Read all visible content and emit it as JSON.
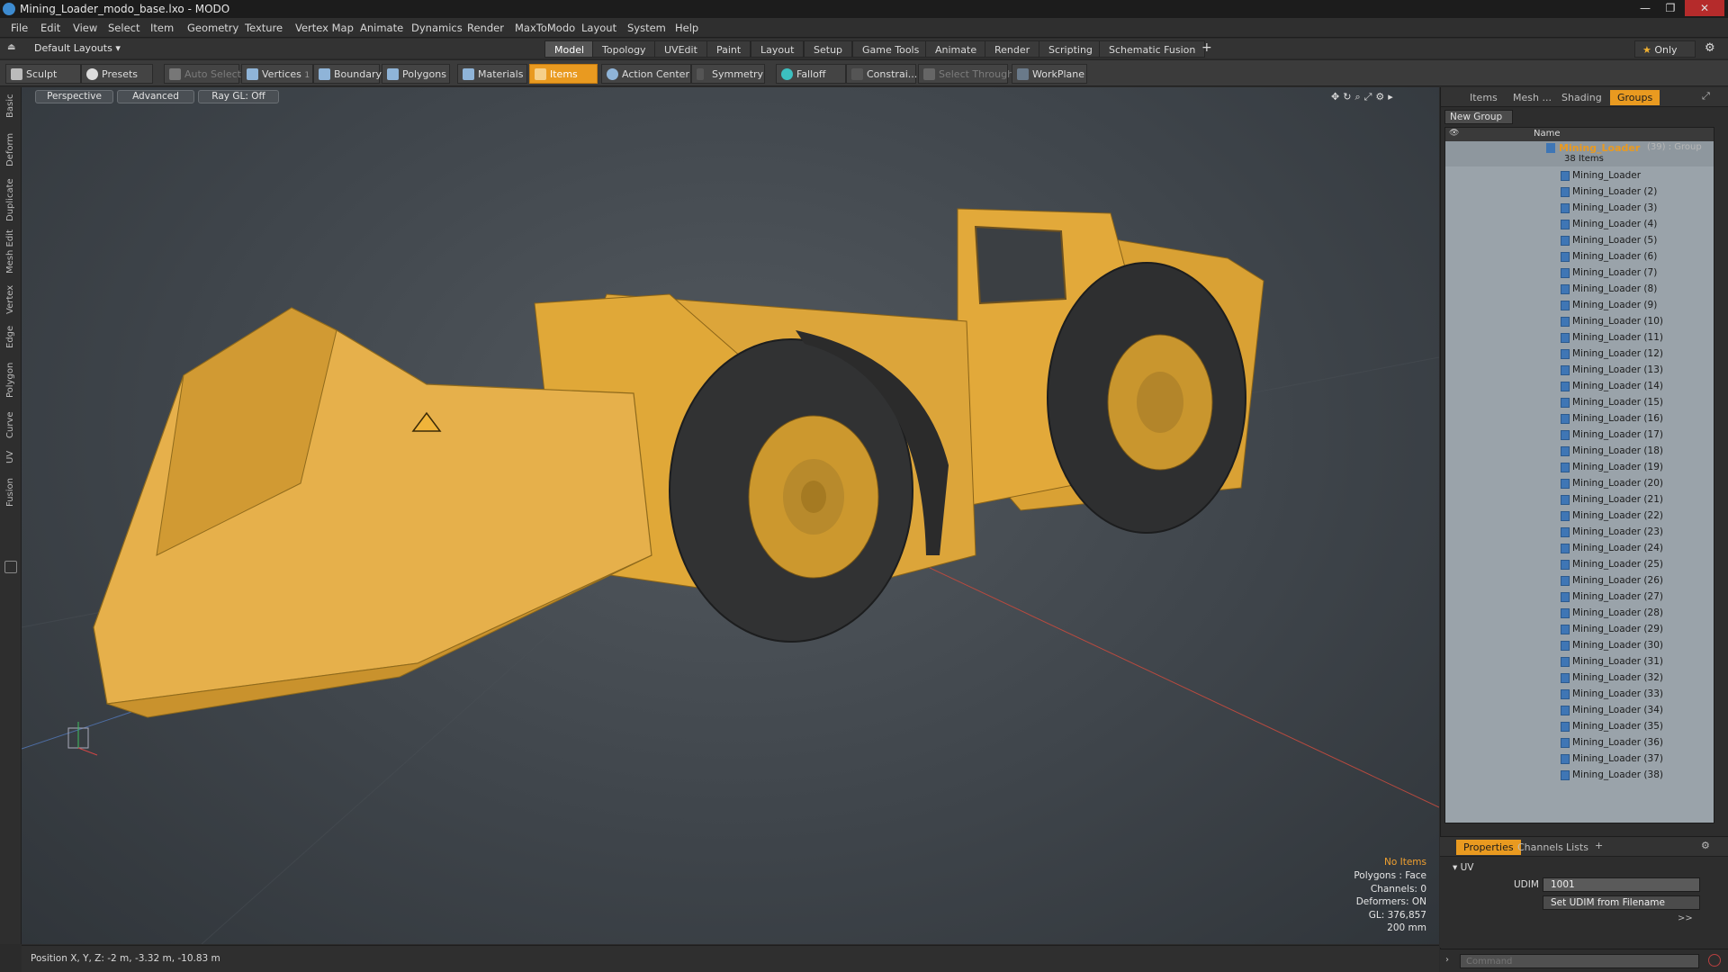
{
  "window": {
    "title": "Mining_Loader_modo_base.lxo - MODO"
  },
  "menu": [
    "File",
    "Edit",
    "View",
    "Select",
    "Item",
    "Geometry",
    "Texture",
    "Vertex Map",
    "Animate",
    "Dynamics",
    "Render",
    "MaxToModo",
    "Layout",
    "System",
    "Help"
  ],
  "layout_bar": {
    "layout_selector": "Default Layouts",
    "tabs": [
      "Model",
      "Topology",
      "UVEdit",
      "Paint",
      "Layout",
      "Setup",
      "Game Tools",
      "Animate",
      "Render",
      "Scripting",
      "Schematic Fusion"
    ],
    "active_tab": "Model",
    "plus": "+",
    "only_label": "Only"
  },
  "toolbar": {
    "sculpt": "Sculpt",
    "presets": "Presets",
    "auto_select": "Auto Select",
    "vertices": "Vertices",
    "vertices_count": "1",
    "boundary": "Boundary",
    "polygons": "Polygons",
    "materials": "Materials",
    "items": "Items",
    "action_center": "Action Center",
    "symmetry": "Symmetry",
    "falloff": "Falloff",
    "constrain": "Constrai...",
    "select_through": "Select Through",
    "workplane": "WorkPlane"
  },
  "left_tabs": [
    "Basic",
    "Deform",
    "Duplicate",
    "Mesh Edit",
    "Vertex",
    "Edge",
    "Polygon",
    "Curve",
    "UV",
    "Fusion"
  ],
  "viewport": {
    "view_mode": "Perspective",
    "shading": "Advanced",
    "raygl": "Ray GL: Off",
    "info": {
      "selection": "No Items",
      "polygons": "Polygons : Face",
      "channels": "Channels: 0",
      "deformers": "Deformers: ON",
      "gl": "GL: 376,857",
      "scale": "200 mm"
    },
    "position": "Position X, Y, Z:  -2 m, -3.32 m, -10.83 m"
  },
  "right_panel": {
    "tabs": [
      "Items",
      "Mesh ...",
      "Shading",
      "Groups"
    ],
    "active_tab": "Groups",
    "new_group": "New Group",
    "column_name": "Name",
    "group": {
      "name": "Mining_Loader",
      "count_suffix": "(39) : Group",
      "items_label": "38 Items"
    },
    "items": [
      "Mining_Loader",
      "Mining_Loader (2)",
      "Mining_Loader (3)",
      "Mining_Loader (4)",
      "Mining_Loader (5)",
      "Mining_Loader (6)",
      "Mining_Loader (7)",
      "Mining_Loader (8)",
      "Mining_Loader (9)",
      "Mining_Loader (10)",
      "Mining_Loader (11)",
      "Mining_Loader (12)",
      "Mining_Loader (13)",
      "Mining_Loader (14)",
      "Mining_Loader (15)",
      "Mining_Loader (16)",
      "Mining_Loader (17)",
      "Mining_Loader (18)",
      "Mining_Loader (19)",
      "Mining_Loader (20)",
      "Mining_Loader (21)",
      "Mining_Loader (22)",
      "Mining_Loader (23)",
      "Mining_Loader (24)",
      "Mining_Loader (25)",
      "Mining_Loader (26)",
      "Mining_Loader (27)",
      "Mining_Loader (28)",
      "Mining_Loader (29)",
      "Mining_Loader (30)",
      "Mining_Loader (31)",
      "Mining_Loader (32)",
      "Mining_Loader (33)",
      "Mining_Loader (34)",
      "Mining_Loader (35)",
      "Mining_Loader (36)",
      "Mining_Loader (37)",
      "Mining_Loader (38)"
    ]
  },
  "properties": {
    "tabs": [
      "Properties",
      "Channels",
      "Lists"
    ],
    "active_tab": "Properties",
    "plus": "+",
    "section": "UV",
    "udim_label": "UDIM",
    "udim_value": "1001",
    "set_udim_button": "Set UDIM from Filename",
    "more": ">>"
  },
  "command": {
    "placeholder": "Command"
  },
  "colors": {
    "accent": "#e99a20",
    "model_yellow": "#e2a93a",
    "tire": "#2e2f30"
  }
}
